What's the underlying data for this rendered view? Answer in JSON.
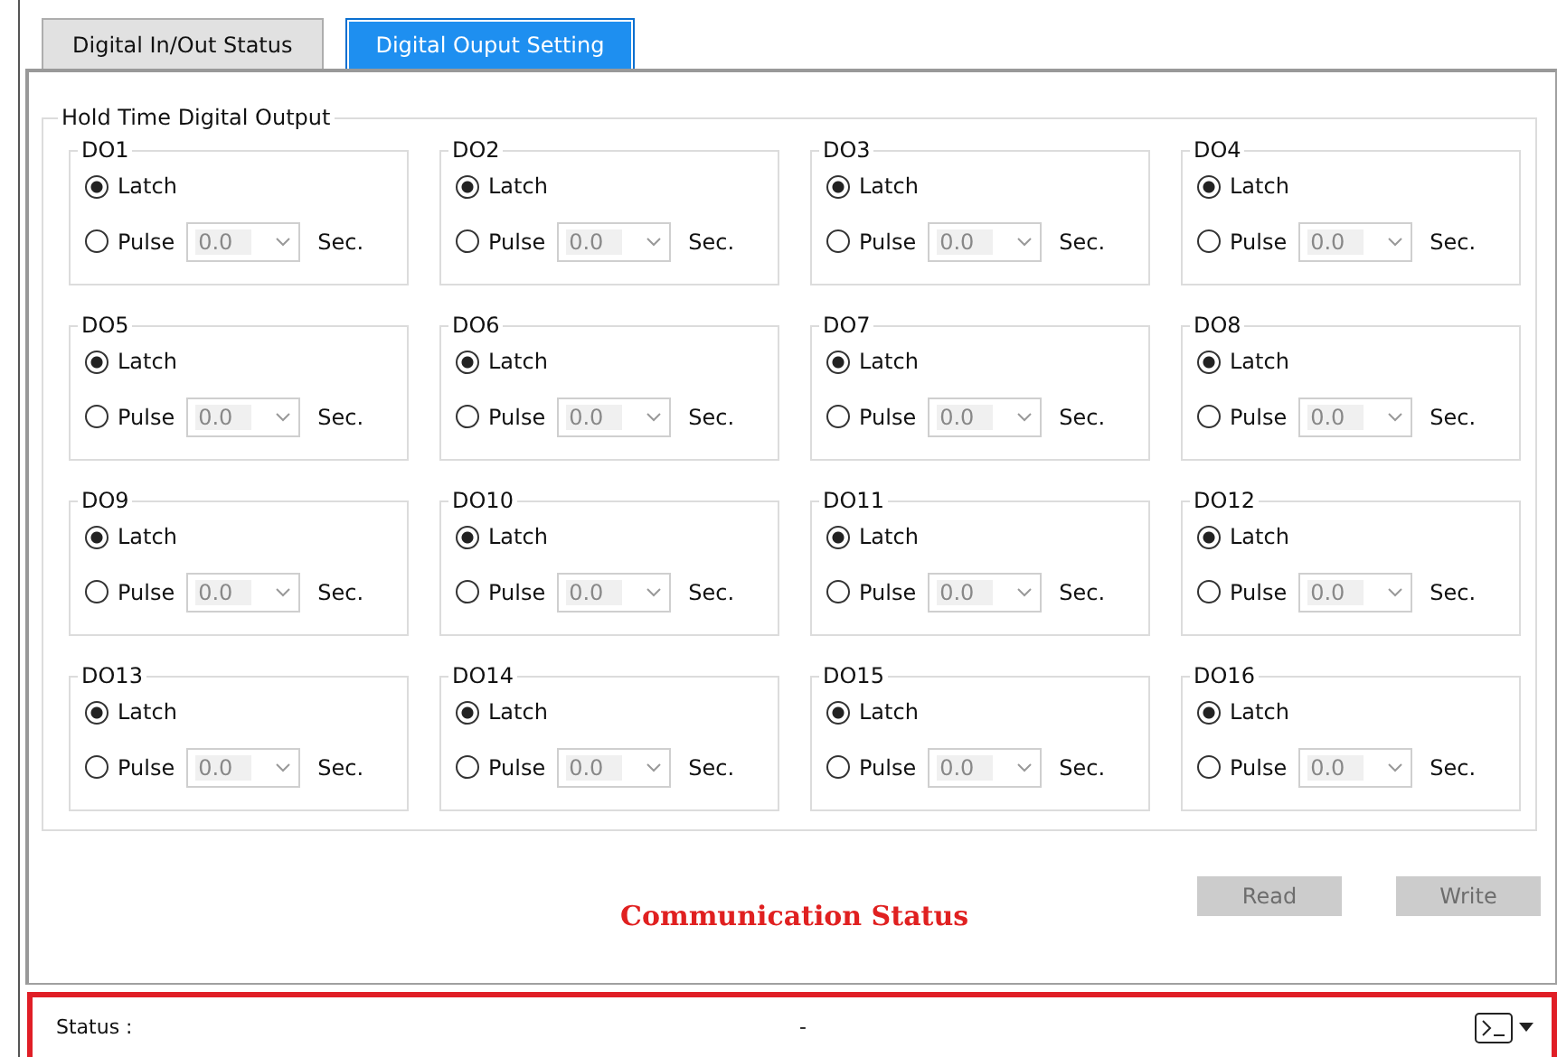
{
  "tabs": [
    {
      "label": "Digital In/Out Status",
      "selected": false
    },
    {
      "label": "Digital Ouput Setting",
      "selected": true
    }
  ],
  "group_title": "Hold Time Digital Output",
  "outputs": [
    {
      "name": "DO1",
      "latch": "Latch",
      "pulse": "Pulse",
      "latch_selected": true,
      "value": "0.0",
      "unit": "Sec."
    },
    {
      "name": "DO2",
      "latch": "Latch",
      "pulse": "Pulse",
      "latch_selected": true,
      "value": "0.0",
      "unit": "Sec."
    },
    {
      "name": "DO3",
      "latch": "Latch",
      "pulse": "Pulse",
      "latch_selected": true,
      "value": "0.0",
      "unit": "Sec."
    },
    {
      "name": "DO4",
      "latch": "Latch",
      "pulse": "Pulse",
      "latch_selected": true,
      "value": "0.0",
      "unit": "Sec."
    },
    {
      "name": "DO5",
      "latch": "Latch",
      "pulse": "Pulse",
      "latch_selected": true,
      "value": "0.0",
      "unit": "Sec."
    },
    {
      "name": "DO6",
      "latch": "Latch",
      "pulse": "Pulse",
      "latch_selected": true,
      "value": "0.0",
      "unit": "Sec."
    },
    {
      "name": "DO7",
      "latch": "Latch",
      "pulse": "Pulse",
      "latch_selected": true,
      "value": "0.0",
      "unit": "Sec."
    },
    {
      "name": "DO8",
      "latch": "Latch",
      "pulse": "Pulse",
      "latch_selected": true,
      "value": "0.0",
      "unit": "Sec."
    },
    {
      "name": "DO9",
      "latch": "Latch",
      "pulse": "Pulse",
      "latch_selected": true,
      "value": "0.0",
      "unit": "Sec."
    },
    {
      "name": "DO10",
      "latch": "Latch",
      "pulse": "Pulse",
      "latch_selected": true,
      "value": "0.0",
      "unit": "Sec."
    },
    {
      "name": "DO11",
      "latch": "Latch",
      "pulse": "Pulse",
      "latch_selected": true,
      "value": "0.0",
      "unit": "Sec."
    },
    {
      "name": "DO12",
      "latch": "Latch",
      "pulse": "Pulse",
      "latch_selected": true,
      "value": "0.0",
      "unit": "Sec."
    },
    {
      "name": "DO13",
      "latch": "Latch",
      "pulse": "Pulse",
      "latch_selected": true,
      "value": "0.0",
      "unit": "Sec."
    },
    {
      "name": "DO14",
      "latch": "Latch",
      "pulse": "Pulse",
      "latch_selected": true,
      "value": "0.0",
      "unit": "Sec."
    },
    {
      "name": "DO15",
      "latch": "Latch",
      "pulse": "Pulse",
      "latch_selected": true,
      "value": "0.0",
      "unit": "Sec."
    },
    {
      "name": "DO16",
      "latch": "Latch",
      "pulse": "Pulse",
      "latch_selected": true,
      "value": "0.0",
      "unit": "Sec."
    }
  ],
  "buttons": [
    {
      "label": "Read",
      "disabled": true
    },
    {
      "label": "Write",
      "disabled": true
    }
  ],
  "communication_title": "Communication Status",
  "status_bar": {
    "label": "Status :",
    "value": "-"
  }
}
